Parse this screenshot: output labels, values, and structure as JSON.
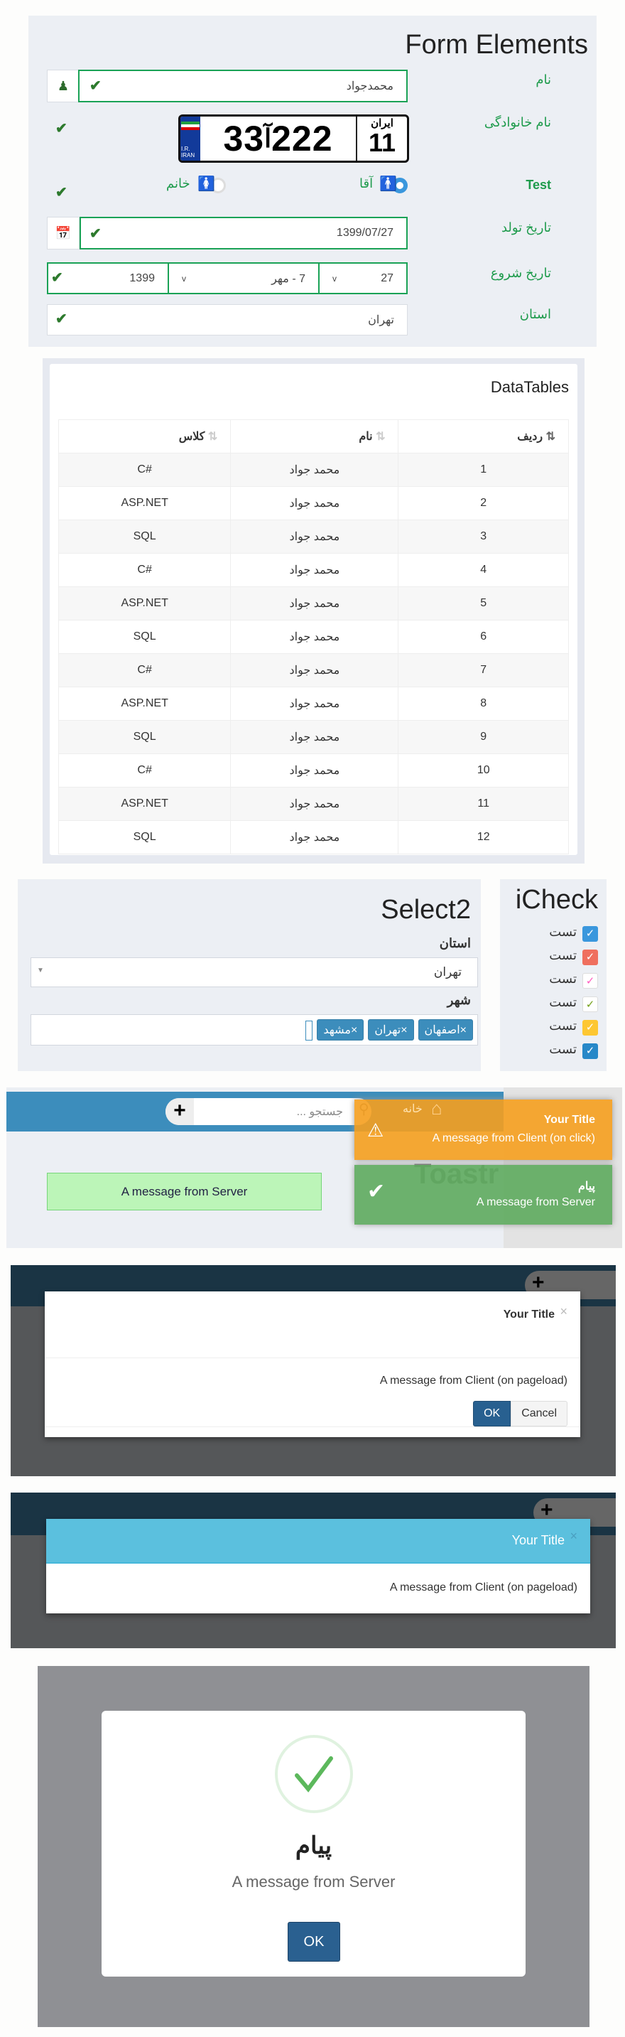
{
  "form": {
    "title": "Form Elements",
    "name": {
      "label": "نام",
      "value": "محمدجواد",
      "icon": "user-icon"
    },
    "family": {
      "label": "نام خانوادگی",
      "plate": {
        "left": "33",
        "letter": "آ",
        "right": "222",
        "region_label": "ایران",
        "region": "11",
        "country": "I.R. IRAN"
      }
    },
    "gender": {
      "label": "Test",
      "options": [
        {
          "label": "آقا",
          "selected": true
        },
        {
          "label": "خانم",
          "selected": false
        }
      ]
    },
    "birth": {
      "label": "تاریخ تولد",
      "value": "1399/07/27",
      "icon": "calendar-icon"
    },
    "start": {
      "label": "تاریخ شروع",
      "day": "27",
      "month": "7 - مهر",
      "year": "1399"
    },
    "province": {
      "label": "استان",
      "value": "تهران"
    }
  },
  "datatable": {
    "title": "DataTables",
    "columns": [
      "ردیف",
      "نام",
      "کلاس"
    ],
    "rows": [
      [
        "1",
        "محمد جواد",
        "C#"
      ],
      [
        "2",
        "محمد جواد",
        "ASP.NET"
      ],
      [
        "3",
        "محمد جواد",
        "SQL"
      ],
      [
        "4",
        "محمد جواد",
        "C#"
      ],
      [
        "5",
        "محمد جواد",
        "ASP.NET"
      ],
      [
        "6",
        "محمد جواد",
        "SQL"
      ],
      [
        "7",
        "محمد جواد",
        "C#"
      ],
      [
        "8",
        "محمد جواد",
        "ASP.NET"
      ],
      [
        "9",
        "محمد جواد",
        "SQL"
      ],
      [
        "10",
        "محمد جواد",
        "C#"
      ],
      [
        "11",
        "محمد جواد",
        "ASP.NET"
      ],
      [
        "12",
        "محمد جواد",
        "SQL"
      ]
    ]
  },
  "select2": {
    "title": "Select2",
    "province_label": "استان",
    "province_value": "تهران",
    "city_label": "شهر",
    "cities": [
      "اصفهان",
      "تهران",
      "مشهد"
    ]
  },
  "icheck": {
    "title": "iCheck",
    "items": [
      {
        "label": "تست",
        "color": "#3a97dd"
      },
      {
        "label": "تست",
        "color": "#ef6f5e"
      },
      {
        "label": "تست",
        "color": "#ff5dbf"
      },
      {
        "label": "تست",
        "color": "#73a019"
      },
      {
        "label": "تست",
        "color": "#fdc732"
      },
      {
        "label": "تست",
        "color": "#2788c8"
      }
    ]
  },
  "toastr": {
    "search_placeholder": "جستجو ...",
    "home": "خانه",
    "heading": "Toastr",
    "server_box": "A message from Server",
    "warning": {
      "title": "Your Title",
      "message": "A message from Client (on click)"
    },
    "success": {
      "title": "پیام",
      "message": "A message from Server"
    }
  },
  "modal1": {
    "title": "Your Title",
    "message": "A message from Client (on pageload)",
    "ok": "OK",
    "cancel": "Cancel"
  },
  "modal2": {
    "title": "Your Title",
    "message": "A message from Client (on pageload)"
  },
  "sweetalert": {
    "title": "پیام",
    "message": "A message from Server",
    "ok": "OK"
  }
}
